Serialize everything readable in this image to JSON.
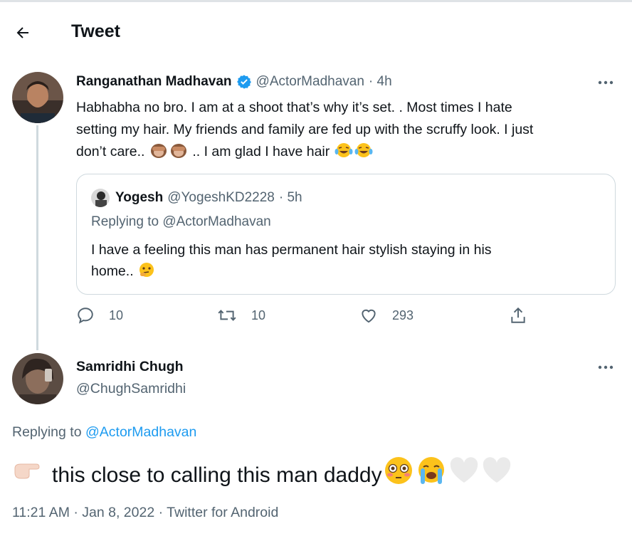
{
  "header": {
    "title": "Tweet"
  },
  "original": {
    "name": "Ranganathan Madhavan",
    "handle": "@ActorMadhavan",
    "time": "· 4h",
    "text_line1": "Habhabha no bro. I am at a shoot that’s why it’s set.  . Most times I hate",
    "text_line2": "setting my hair. My friends and family are fed up with the scruffy look. I just",
    "text_line3a": "don’t care..",
    "text_line3b": ".. I am glad I have hair",
    "quote": {
      "name": "Yogesh",
      "handle": "@YogeshKD2228",
      "time": "· 5h",
      "replying_prefix": "Replying to ",
      "replying_handle": "@ActorMadhavan",
      "text_line1": "I have a feeling this man has permanent hair stylish staying in his",
      "text_line2": "home.."
    },
    "stats": {
      "replies": "10",
      "retweets": "10",
      "likes": "293"
    }
  },
  "reply": {
    "name": "Samridhi Chugh",
    "handle": "@ChughSamridhi",
    "replying_prefix": "Replying to ",
    "replying_handle": "@ActorMadhavan",
    "text": "this close to calling this man daddy",
    "timestamp": "11:21 AM · Jan 8, 2022 · Twitter for Android"
  },
  "colors": {
    "accent": "#1d9bf0",
    "muted": "#536471",
    "border": "#cfd9de",
    "text": "#0f1419"
  },
  "icons": [
    "back-arrow-icon",
    "verified-badge-icon",
    "more-icon",
    "reply-icon",
    "retweet-icon",
    "like-icon",
    "share-icon",
    "see-no-evil-monkey-emoji",
    "laughing-tears-emoji",
    "thinking-face-emoji",
    "pointing-hand-emoji",
    "flushed-face-emoji",
    "loudly-crying-face-emoji",
    "white-heart-emoji"
  ]
}
